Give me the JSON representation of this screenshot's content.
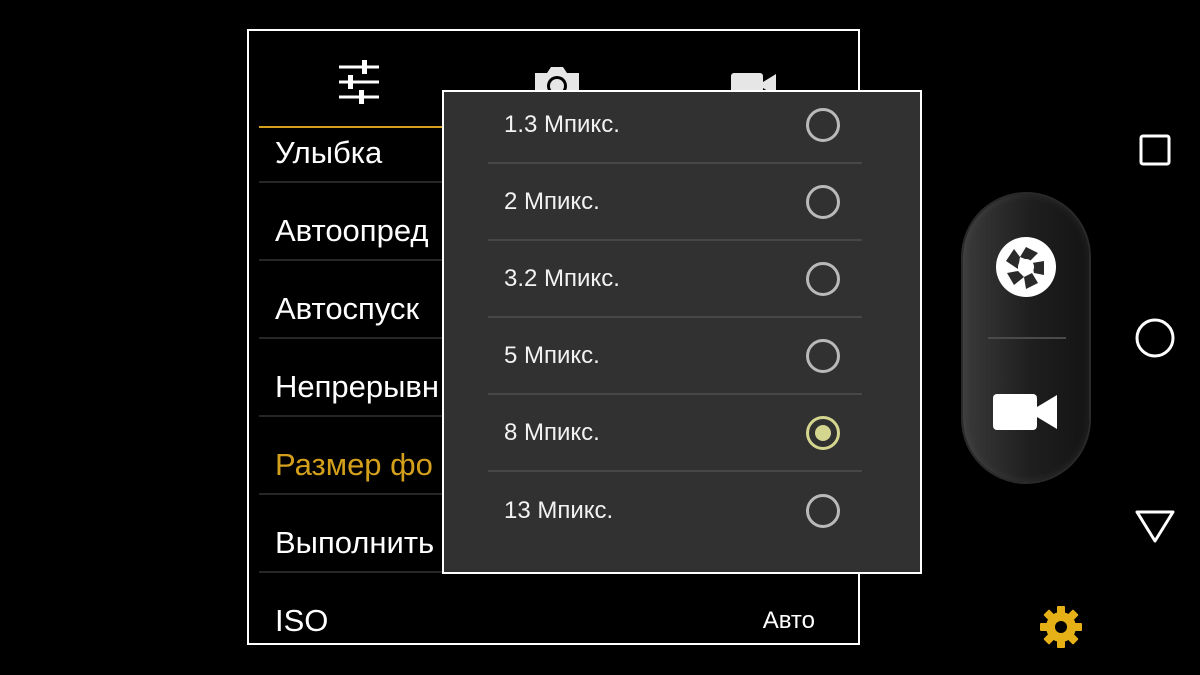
{
  "settings_tabs": [
    {
      "id": "general",
      "icon": "sliders-icon",
      "active": true
    },
    {
      "id": "photo",
      "icon": "camera-icon",
      "active": false
    },
    {
      "id": "video",
      "icon": "video-camera-icon",
      "active": false
    }
  ],
  "settings": [
    {
      "label": "Улыбка"
    },
    {
      "label": "Автоопред"
    },
    {
      "label": "Автоспуск"
    },
    {
      "label": "Непрерывн"
    },
    {
      "label": "Размер фо",
      "active": true
    },
    {
      "label": "Выполнить"
    },
    {
      "label": "ISO",
      "value": "Авто"
    }
  ],
  "photo_size_dropdown": {
    "options": [
      {
        "label": "1.3 Мпикс.",
        "selected": false
      },
      {
        "label": "2 Мпикс.",
        "selected": false
      },
      {
        "label": "3.2 Мпикс.",
        "selected": false
      },
      {
        "label": "5 Мпикс.",
        "selected": false
      },
      {
        "label": "8 Мпикс.",
        "selected": true
      },
      {
        "label": "13 Мпикс.",
        "selected": false
      }
    ]
  },
  "controls": {
    "shutter_icon": "aperture-icon",
    "record_icon": "video-camera-icon",
    "settings_icon": "gear-icon"
  },
  "navigation": {
    "recents_icon": "square-icon",
    "home_icon": "circle-icon",
    "back_icon": "triangle-back-icon"
  },
  "colors": {
    "accent": "#d4a01c",
    "radio_selected": "#d4d58e",
    "dropdown_bg": "#313131",
    "background": "#000000"
  }
}
